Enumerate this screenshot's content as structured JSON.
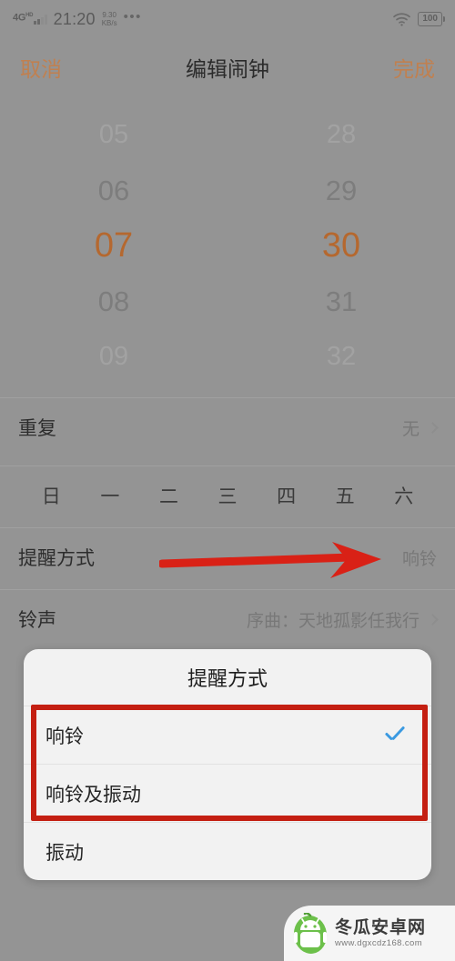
{
  "statusbar": {
    "network_type": "4G",
    "network_sup": "HD",
    "time": "21:20",
    "speed_value": "9.30",
    "speed_unit": "KB/s",
    "more_dots": "•••",
    "wifi_icon": "wifi-icon",
    "battery_level": "100"
  },
  "header": {
    "cancel_label": "取消",
    "title": "编辑闹钟",
    "done_label": "完成",
    "accent_color": "#c08050"
  },
  "time_picker": {
    "hours": [
      "05",
      "06",
      "07",
      "08",
      "09"
    ],
    "minutes": [
      "28",
      "29",
      "30",
      "31",
      "32"
    ],
    "selected_hour": "07",
    "selected_minute": "30",
    "selected_color": "#b5682f"
  },
  "rows": {
    "repeat": {
      "label": "重复",
      "value": "无"
    },
    "weekdays": [
      "日",
      "一",
      "二",
      "三",
      "四",
      "五",
      "六"
    ],
    "reminder": {
      "label": "提醒方式",
      "value": "响铃"
    },
    "ringtone": {
      "label": "铃声",
      "value": "序曲：天地孤影任我行"
    }
  },
  "annotation": {
    "arrow_color": "#d92116",
    "highlight_box_color": "#c41f12"
  },
  "dialog": {
    "title": "提醒方式",
    "options": [
      {
        "label": "响铃",
        "checked": true
      },
      {
        "label": "响铃及振动",
        "checked": false
      },
      {
        "label": "振动",
        "checked": false
      }
    ],
    "check_color": "#3b9ae1"
  },
  "watermark": {
    "logo_icon": "winter-melon-android-logo",
    "site_name": "冬瓜安卓网",
    "site_url": "www.dgxcdz168.com"
  }
}
